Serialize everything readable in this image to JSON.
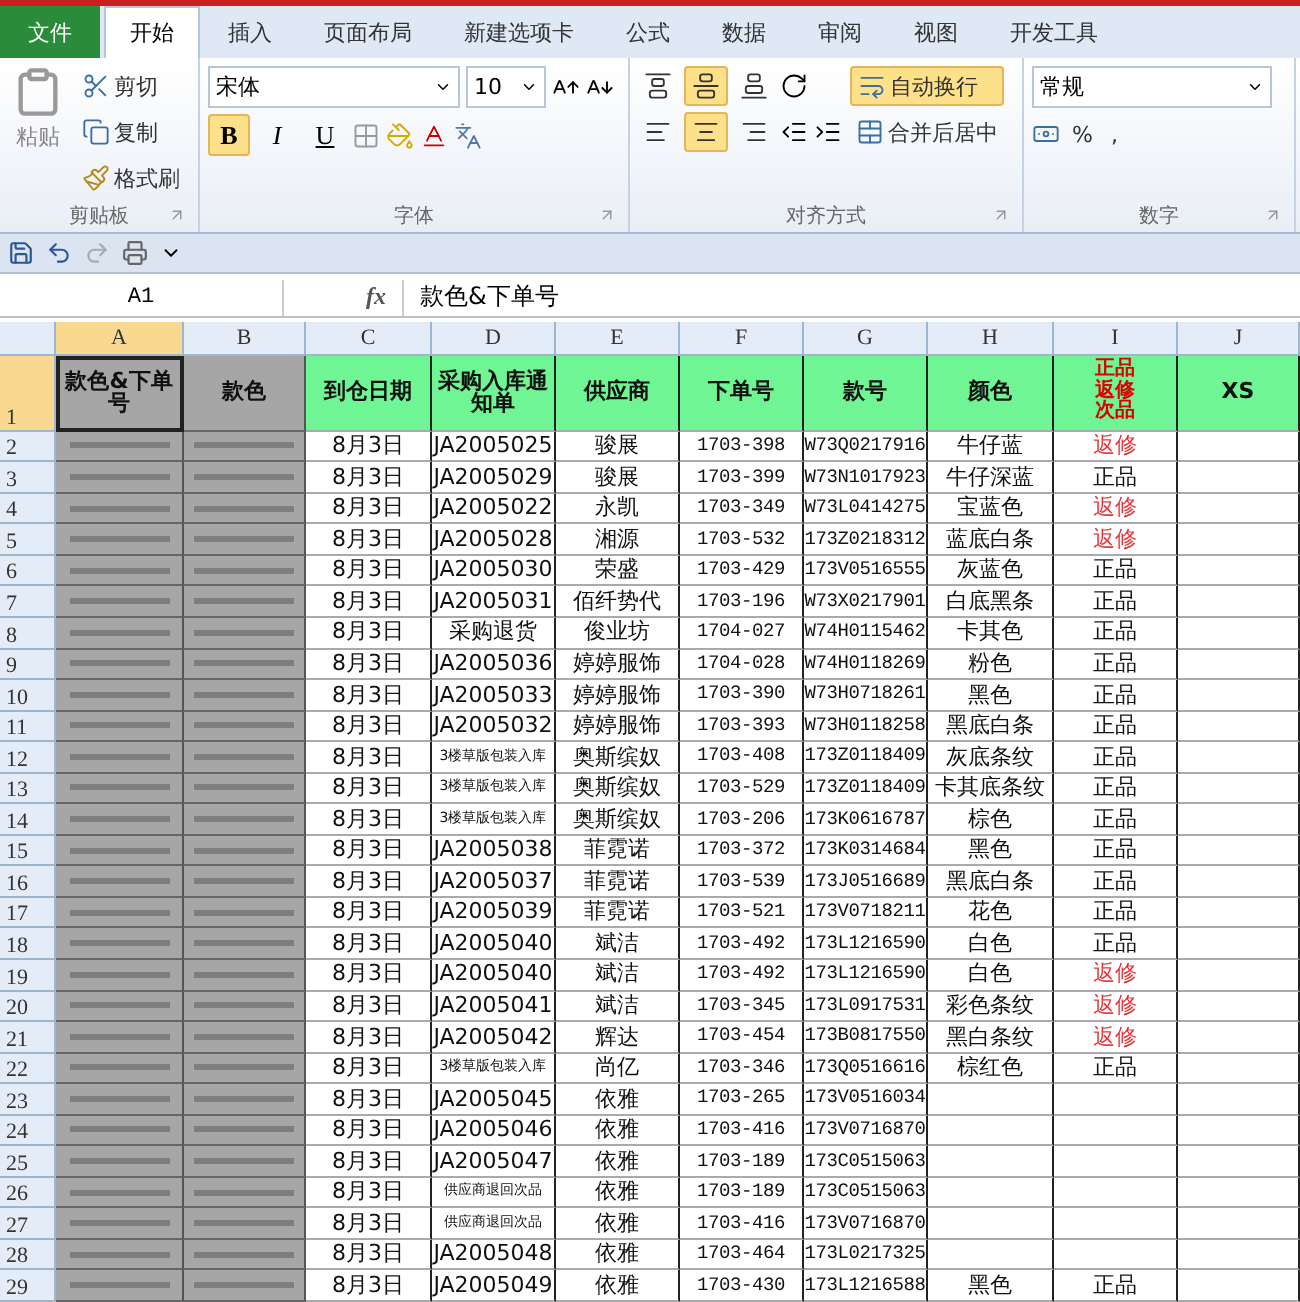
{
  "ribbon_tabs": [
    {
      "label": "文件",
      "kind": "file",
      "selected": false
    },
    {
      "label": "开始",
      "kind": "tab",
      "selected": true
    },
    {
      "label": "插入",
      "kind": "tab",
      "selected": false
    },
    {
      "label": "页面布局",
      "kind": "tab",
      "selected": false
    },
    {
      "label": "新建选项卡",
      "kind": "tab",
      "selected": false
    },
    {
      "label": "公式",
      "kind": "tab",
      "selected": false
    },
    {
      "label": "数据",
      "kind": "tab",
      "selected": false
    },
    {
      "label": "审阅",
      "kind": "tab",
      "selected": false
    },
    {
      "label": "视图",
      "kind": "tab",
      "selected": false
    },
    {
      "label": "开发工具",
      "kind": "tab",
      "selected": false
    }
  ],
  "clipboard": {
    "title": "剪贴板",
    "paste": "粘贴",
    "cut": "剪切",
    "copy": "复制",
    "format_painter": "格式刷"
  },
  "font": {
    "title": "字体",
    "name": "宋体",
    "size": "10",
    "bold_label": "B",
    "italic_label": "I",
    "underline_label": "U",
    "bold": true
  },
  "alignment": {
    "title": "对齐方式",
    "wrap": "自动换行",
    "wrap_on": true,
    "merge": "合并后居中",
    "middle_on": true,
    "center_on": true
  },
  "number": {
    "title": "数字",
    "format": "常规",
    "percent": "%",
    "comma": ","
  },
  "formula_bar": {
    "cell": "A1",
    "fx": "fx",
    "value": "款色&下单号"
  },
  "columns": [
    {
      "label": "A",
      "selected": true
    },
    {
      "label": "B",
      "selected": false
    },
    {
      "label": "C",
      "selected": false
    },
    {
      "label": "D",
      "selected": false
    },
    {
      "label": "E",
      "selected": false
    },
    {
      "label": "F",
      "selected": false
    },
    {
      "label": "G",
      "selected": false
    },
    {
      "label": "H",
      "selected": false
    },
    {
      "label": "I",
      "selected": false
    },
    {
      "label": "J",
      "selected": false
    }
  ],
  "header_row": {
    "number": "1",
    "selected": true,
    "cells": [
      {
        "kind": "grey",
        "text": "款色&下单号"
      },
      {
        "kind": "grey",
        "text": "款色"
      },
      {
        "kind": "green",
        "text": "到仓日期"
      },
      {
        "kind": "green",
        "text": "采购入库通知单"
      },
      {
        "kind": "green",
        "text": "供应商"
      },
      {
        "kind": "green",
        "text": "下单号"
      },
      {
        "kind": "green",
        "text": "款号"
      },
      {
        "kind": "green",
        "text": "颜色"
      },
      {
        "kind": "status",
        "lines": [
          "正品",
          "返修",
          "次品"
        ]
      },
      {
        "kind": "green",
        "text": "XS"
      }
    ]
  },
  "rows": [
    {
      "number": "2",
      "date": "8月3日",
      "notice": {
        "text": "JA2005025",
        "kind": "code"
      },
      "supplier": "骏展",
      "order": "1703-398",
      "style": "W73Q0217916",
      "shade": "牛仔蓝",
      "status": {
        "text": "返修",
        "kind": "repair"
      }
    },
    {
      "number": "3",
      "date": "8月3日",
      "notice": {
        "text": "JA2005029",
        "kind": "code"
      },
      "supplier": "骏展",
      "order": "1703-399",
      "style": "W73N1017923",
      "shade": "牛仔深蓝",
      "status": {
        "text": "正品",
        "kind": "normal"
      }
    },
    {
      "number": "4",
      "date": "8月3日",
      "notice": {
        "text": "JA2005022",
        "kind": "code"
      },
      "supplier": "永凯",
      "order": "1703-349",
      "style": "W73L0414275",
      "shade": "宝蓝色",
      "status": {
        "text": "返修",
        "kind": "repair"
      }
    },
    {
      "number": "5",
      "date": "8月3日",
      "notice": {
        "text": "JA2005028",
        "kind": "code"
      },
      "supplier": "湘源",
      "order": "1703-532",
      "style": "173Z0218312",
      "shade": "蓝底白条",
      "status": {
        "text": "返修",
        "kind": "repair"
      }
    },
    {
      "number": "6",
      "date": "8月3日",
      "notice": {
        "text": "JA2005030",
        "kind": "code"
      },
      "supplier": "荣盛",
      "order": "1703-429",
      "style": "173V0516555",
      "shade": "灰蓝色",
      "status": {
        "text": "正品",
        "kind": "normal"
      }
    },
    {
      "number": "7",
      "date": "8月3日",
      "notice": {
        "text": "JA2005031",
        "kind": "code"
      },
      "supplier": "佰纤势代",
      "order": "1703-196",
      "style": "W73X0217901",
      "shade": "白底黑条",
      "status": {
        "text": "正品",
        "kind": "normal"
      }
    },
    {
      "number": "8",
      "date": "8月3日",
      "notice": {
        "text": "采购退货",
        "kind": "code"
      },
      "supplier": "俊业坊",
      "order": "1704-027",
      "style": "W74H0115462",
      "shade": "卡其色",
      "status": {
        "text": "正品",
        "kind": "normal"
      }
    },
    {
      "number": "9",
      "date": "8月3日",
      "notice": {
        "text": "JA2005036",
        "kind": "code"
      },
      "supplier": "婷婷服饰",
      "order": "1704-028",
      "style": "W74H0118269",
      "shade": "粉色",
      "status": {
        "text": "正品",
        "kind": "normal"
      }
    },
    {
      "number": "10",
      "date": "8月3日",
      "notice": {
        "text": "JA2005033",
        "kind": "code"
      },
      "supplier": "婷婷服饰",
      "order": "1703-390",
      "style": "W73H0718261",
      "shade": "黑色",
      "status": {
        "text": "正品",
        "kind": "normal"
      }
    },
    {
      "number": "11",
      "date": "8月3日",
      "notice": {
        "text": "JA2005032",
        "kind": "code"
      },
      "supplier": "婷婷服饰",
      "order": "1703-393",
      "style": "W73H0118258",
      "shade": "黑底白条",
      "status": {
        "text": "正品",
        "kind": "normal"
      }
    },
    {
      "number": "12",
      "date": "8月3日",
      "notice": {
        "text": "3楼草版包装入库",
        "kind": "small"
      },
      "supplier": "奥斯缤奴",
      "order": "1703-408",
      "style": "173Z0118409",
      "shade": "灰底条纹",
      "status": {
        "text": "正品",
        "kind": "normal"
      }
    },
    {
      "number": "13",
      "date": "8月3日",
      "notice": {
        "text": "3楼草版包装入库",
        "kind": "small"
      },
      "supplier": "奥斯缤奴",
      "order": "1703-529",
      "style": "173Z0118409",
      "shade": "卡其底条纹",
      "status": {
        "text": "正品",
        "kind": "normal"
      }
    },
    {
      "number": "14",
      "date": "8月3日",
      "notice": {
        "text": "3楼草版包装入库",
        "kind": "small"
      },
      "supplier": "奥斯缤奴",
      "order": "1703-206",
      "style": "173K0616787",
      "shade": "棕色",
      "status": {
        "text": "正品",
        "kind": "normal"
      }
    },
    {
      "number": "15",
      "date": "8月3日",
      "notice": {
        "text": "JA2005038",
        "kind": "code"
      },
      "supplier": "菲霓诺",
      "order": "1703-372",
      "style": "173K0314684",
      "shade": "黑色",
      "status": {
        "text": "正品",
        "kind": "normal"
      }
    },
    {
      "number": "16",
      "date": "8月3日",
      "notice": {
        "text": "JA2005037",
        "kind": "code"
      },
      "supplier": "菲霓诺",
      "order": "1703-539",
      "style": "173J0516689",
      "shade": "黑底白条",
      "status": {
        "text": "正品",
        "kind": "normal"
      }
    },
    {
      "number": "17",
      "date": "8月3日",
      "notice": {
        "text": "JA2005039",
        "kind": "code"
      },
      "supplier": "菲霓诺",
      "order": "1703-521",
      "style": "173V0718211",
      "shade": "花色",
      "status": {
        "text": "正品",
        "kind": "normal"
      }
    },
    {
      "number": "18",
      "date": "8月3日",
      "notice": {
        "text": "JA2005040",
        "kind": "code"
      },
      "supplier": "斌洁",
      "order": "1703-492",
      "style": "173L1216590",
      "shade": "白色",
      "status": {
        "text": "正品",
        "kind": "normal"
      }
    },
    {
      "number": "19",
      "date": "8月3日",
      "notice": {
        "text": "JA2005040",
        "kind": "code"
      },
      "supplier": "斌洁",
      "order": "1703-492",
      "style": "173L1216590",
      "shade": "白色",
      "status": {
        "text": "返修",
        "kind": "repair"
      }
    },
    {
      "number": "20",
      "date": "8月3日",
      "notice": {
        "text": "JA2005041",
        "kind": "code"
      },
      "supplier": "斌洁",
      "order": "1703-345",
      "style": "173L0917531",
      "shade": "彩色条纹",
      "status": {
        "text": "返修",
        "kind": "repair"
      }
    },
    {
      "number": "21",
      "date": "8月3日",
      "notice": {
        "text": "JA2005042",
        "kind": "code"
      },
      "supplier": "辉达",
      "order": "1703-454",
      "style": "173B0817550",
      "shade": "黑白条纹",
      "status": {
        "text": "返修",
        "kind": "repair"
      }
    },
    {
      "number": "22",
      "date": "8月3日",
      "notice": {
        "text": "3楼草版包装入库",
        "kind": "small"
      },
      "supplier": "尚亿",
      "order": "1703-346",
      "style": "173Q0516616",
      "shade": "棕红色",
      "status": {
        "text": "正品",
        "kind": "normal"
      }
    },
    {
      "number": "23",
      "date": "8月3日",
      "notice": {
        "text": "JA2005045",
        "kind": "code"
      },
      "supplier": "依雅",
      "order": "1703-265",
      "style": "173V0516034"
    },
    {
      "number": "24",
      "date": "8月3日",
      "notice": {
        "text": "JA2005046",
        "kind": "code"
      },
      "supplier": "依雅",
      "order": "1703-416",
      "style": "173V0716870"
    },
    {
      "number": "25",
      "date": "8月3日",
      "notice": {
        "text": "JA2005047",
        "kind": "code"
      },
      "supplier": "依雅",
      "order": "1703-189",
      "style": "173C0515063"
    },
    {
      "number": "26",
      "date": "8月3日",
      "notice": {
        "text": "供应商退回次品",
        "kind": "small"
      },
      "supplier": "依雅",
      "order": "1703-189",
      "style": "173C0515063"
    },
    {
      "number": "27",
      "date": "8月3日",
      "notice": {
        "text": "供应商退回次品",
        "kind": "small"
      },
      "supplier": "依雅",
      "order": "1703-416",
      "style": "173V0716870"
    },
    {
      "number": "28",
      "date": "8月3日",
      "notice": {
        "text": "JA2005048",
        "kind": "code"
      },
      "supplier": "依雅",
      "order": "1703-464",
      "style": "173L0217325"
    },
    {
      "number": "29",
      "date": "8月3日",
      "notice": {
        "text": "JA2005049",
        "kind": "code"
      },
      "supplier": "依雅",
      "order": "1703-430",
      "style": "173L1216588",
      "shade": "黑色",
      "status": {
        "text": "正品",
        "kind": "normal"
      }
    }
  ]
}
